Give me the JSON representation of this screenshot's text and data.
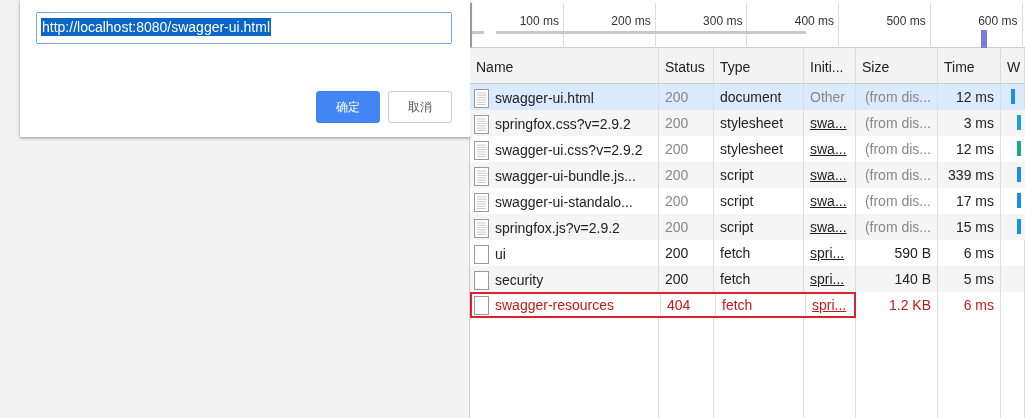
{
  "dialog": {
    "url_value": "http://localhost:8080/swagger-ui.html",
    "buttons": [
      {
        "label": "确定",
        "kind": "primary"
      },
      {
        "label": "取消",
        "kind": "secondary"
      }
    ]
  },
  "timeline": {
    "ticks": [
      "100 ms",
      "200 ms",
      "300 ms",
      "400 ms",
      "500 ms",
      "600 ms"
    ]
  },
  "table": {
    "columns": [
      "Name",
      "Status",
      "Type",
      "Initi...",
      "Size",
      "Time",
      "W"
    ],
    "rows": [
      {
        "name": "swagger-ui.html",
        "status": "200",
        "type": "document",
        "initiator": "Other",
        "size": "(from dis...",
        "time": "12 ms",
        "kind": "document",
        "selected": true,
        "cached": true,
        "error": false,
        "highlighted": false,
        "color": "#1a8fe3"
      },
      {
        "name": "springfox.css?v=2.9.2",
        "status": "200",
        "type": "stylesheet",
        "initiator": "swa...",
        "size": "(from dis...",
        "time": "3 ms",
        "kind": "document",
        "selected": false,
        "cached": true,
        "error": false,
        "highlighted": false,
        "color": "#1a9fe3"
      },
      {
        "name": "swagger-ui.css?v=2.9.2",
        "status": "200",
        "type": "stylesheet",
        "initiator": "swa...",
        "size": "(from dis...",
        "time": "12 ms",
        "kind": "document",
        "selected": false,
        "cached": true,
        "error": false,
        "highlighted": false,
        "color": "#1aa88f"
      },
      {
        "name": "swagger-ui-bundle.js...",
        "status": "200",
        "type": "script",
        "initiator": "swa...",
        "size": "(from dis...",
        "time": "339 ms",
        "kind": "document",
        "selected": false,
        "cached": true,
        "error": false,
        "highlighted": false,
        "color": "#1a8fe3"
      },
      {
        "name": "swagger-ui-standalo...",
        "status": "200",
        "type": "script",
        "initiator": "swa...",
        "size": "(from dis...",
        "time": "17 ms",
        "kind": "document",
        "selected": false,
        "cached": true,
        "error": false,
        "highlighted": false,
        "color": "#1a8fe3"
      },
      {
        "name": "springfox.js?v=2.9.2",
        "status": "200",
        "type": "script",
        "initiator": "swa...",
        "size": "(from dis...",
        "time": "15 ms",
        "kind": "document",
        "selected": false,
        "cached": true,
        "error": false,
        "highlighted": false,
        "color": "#1a8fe3"
      },
      {
        "name": "ui",
        "status": "200",
        "type": "fetch",
        "initiator": "spri...",
        "size": "590 B",
        "time": "6 ms",
        "kind": "blank",
        "selected": false,
        "cached": false,
        "error": false,
        "highlighted": false
      },
      {
        "name": "security",
        "status": "200",
        "type": "fetch",
        "initiator": "spri...",
        "size": "140 B",
        "time": "5 ms",
        "kind": "blank",
        "selected": false,
        "cached": false,
        "error": false,
        "highlighted": false
      },
      {
        "name": "swagger-resources",
        "status": "404",
        "type": "fetch",
        "initiator": "spri...",
        "size": "1.2 KB",
        "time": "6 ms",
        "kind": "blank",
        "selected": false,
        "cached": false,
        "error": true,
        "highlighted": true
      }
    ]
  }
}
